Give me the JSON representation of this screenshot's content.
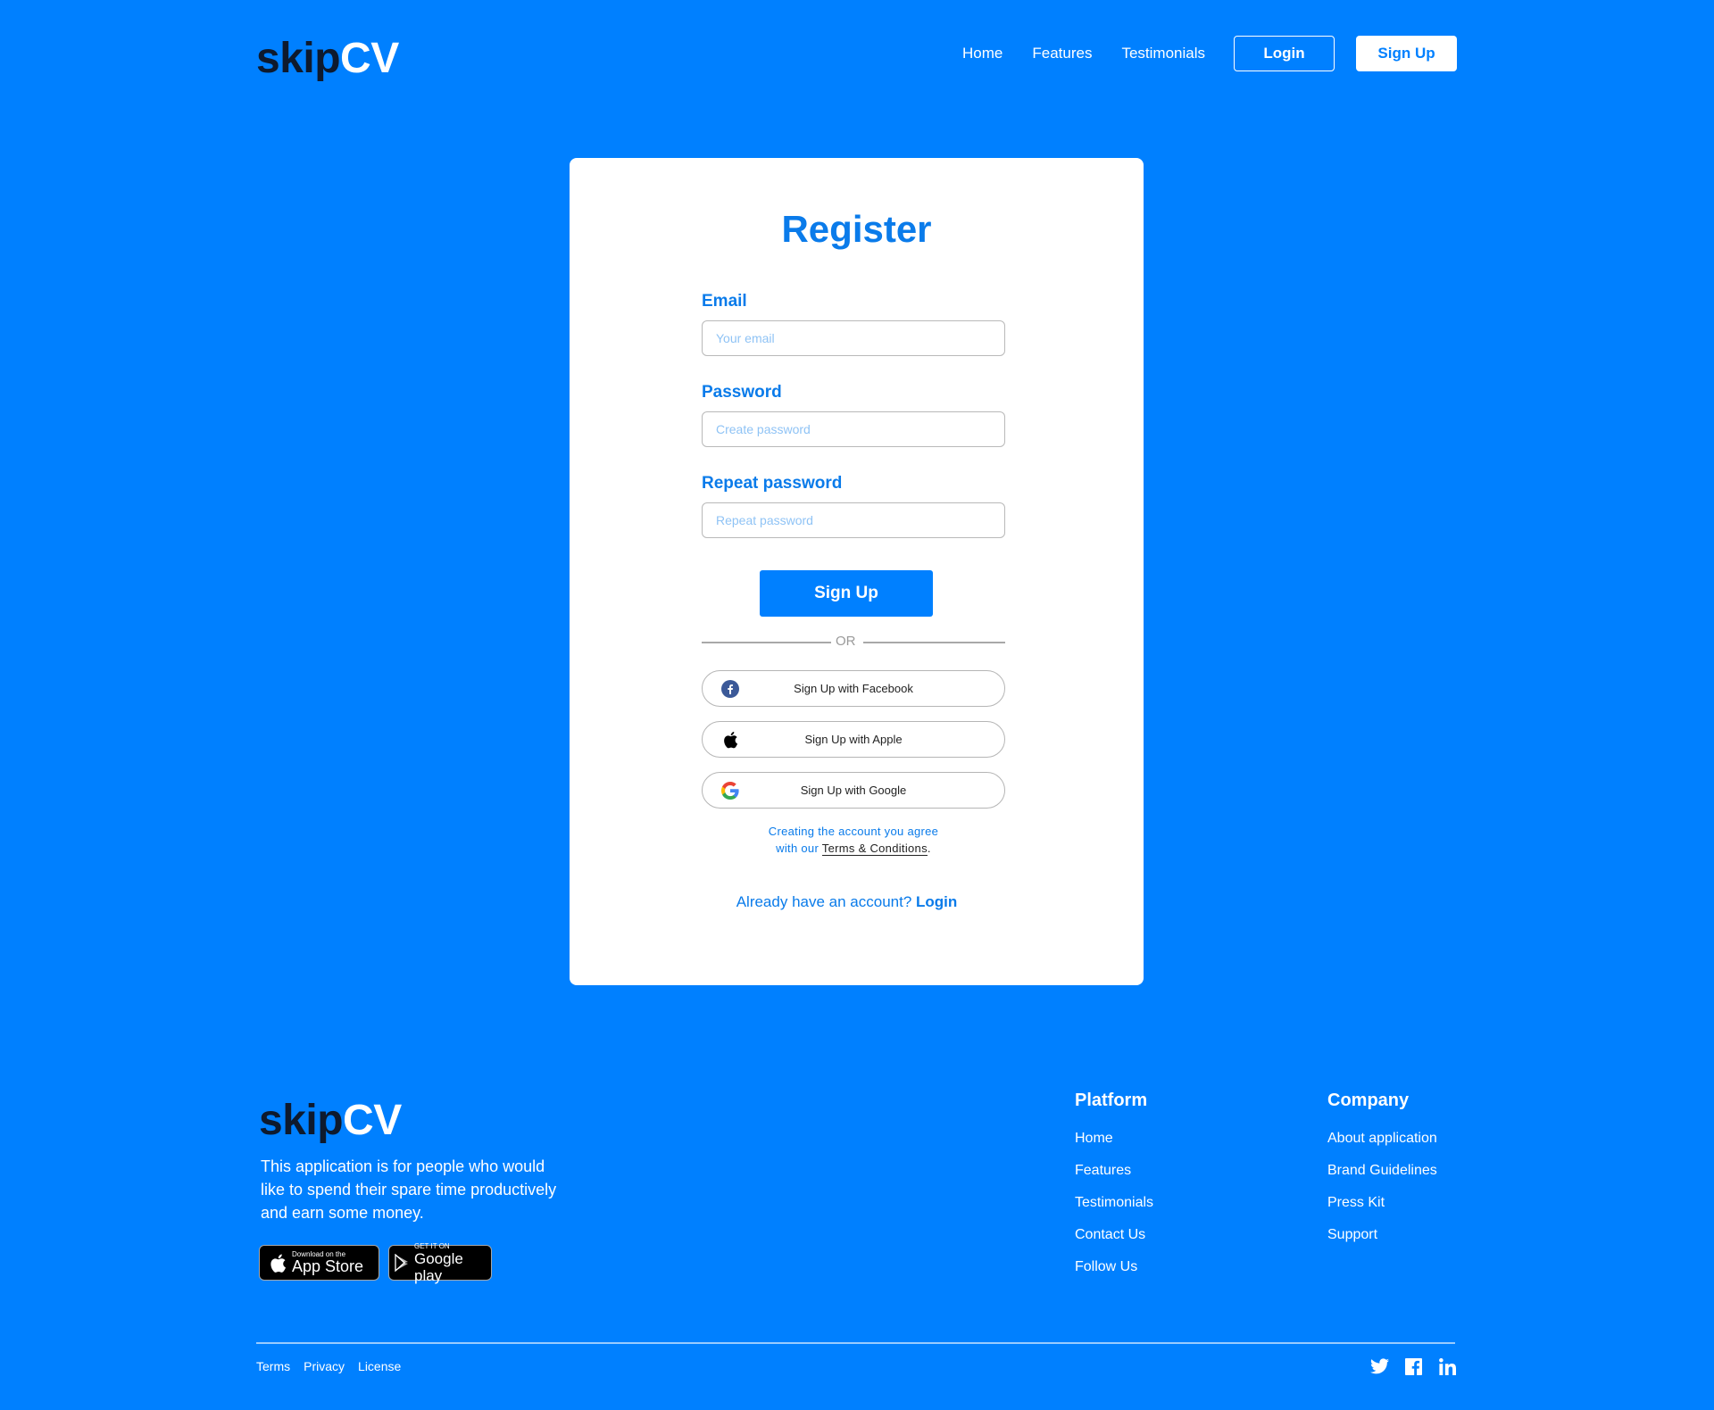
{
  "brand": {
    "part1": "skip",
    "part2": "CV"
  },
  "nav": {
    "links": [
      "Home",
      "Features",
      "Testimonials"
    ],
    "login": "Login",
    "signup": "Sign Up"
  },
  "form": {
    "title": "Register",
    "email_label": "Email",
    "email_placeholder": "Your email",
    "password_label": "Password",
    "password_placeholder": "Create password",
    "repeat_label": "Repeat password",
    "repeat_placeholder": "Repeat password",
    "submit": "Sign Up",
    "or": "OR",
    "facebook": "Sign Up with Facebook",
    "apple": "Sign Up with Apple",
    "google": "Sign Up with Google",
    "terms_line1": "Creating the account you agree",
    "terms_prefix": "with our",
    "terms_link": "Terms & Conditions",
    "terms_suffix": ".",
    "have_account": "Already have an account?",
    "login_link": "Login"
  },
  "footer": {
    "about": "This application is for people who would like to spend their spare time productively and earn some money.",
    "appstore_small": "Download on the",
    "appstore_big": "App Store",
    "gplay_small": "GET IT ON",
    "gplay_big": "Google play",
    "platform_title": "Platform",
    "platform_links": [
      "Home",
      "Features",
      "Testimonials",
      "Contact Us",
      "Follow Us"
    ],
    "company_title": "Company",
    "company_links": [
      "About application",
      "Brand Guidelines",
      "Press Kit",
      "Support"
    ],
    "bottom_links": [
      "Terms",
      "Privacy",
      "License"
    ],
    "social_icons": [
      "twitter-icon",
      "facebook-icon",
      "linkedin-icon"
    ]
  },
  "colors": {
    "background": "#0080FF",
    "accent_text": "#0A7BEA",
    "logo_dark": "#0E1A2E"
  }
}
